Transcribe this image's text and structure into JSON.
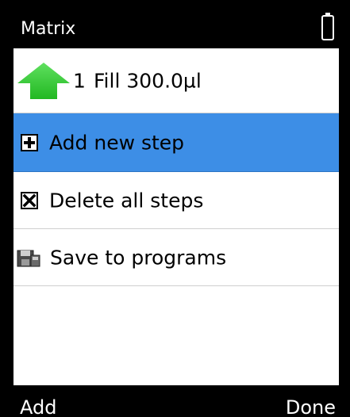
{
  "title": "Matrix",
  "steps": [
    {
      "number": "1",
      "text": "Fill 300.0µl",
      "icon": "green-up-arrow-icon"
    }
  ],
  "menu": [
    {
      "label": "Add new step",
      "icon": "plus-box-icon",
      "selected": true
    },
    {
      "label": "Delete all steps",
      "icon": "x-box-icon",
      "selected": false
    },
    {
      "label": "Save to programs",
      "icon": "save-disk-icon",
      "selected": false
    }
  ],
  "softkeys": {
    "left": "Add",
    "right": "Done"
  },
  "colors": {
    "selection": "#3d8ee6",
    "arrow": "#2fd12f",
    "bar": "#000000"
  }
}
